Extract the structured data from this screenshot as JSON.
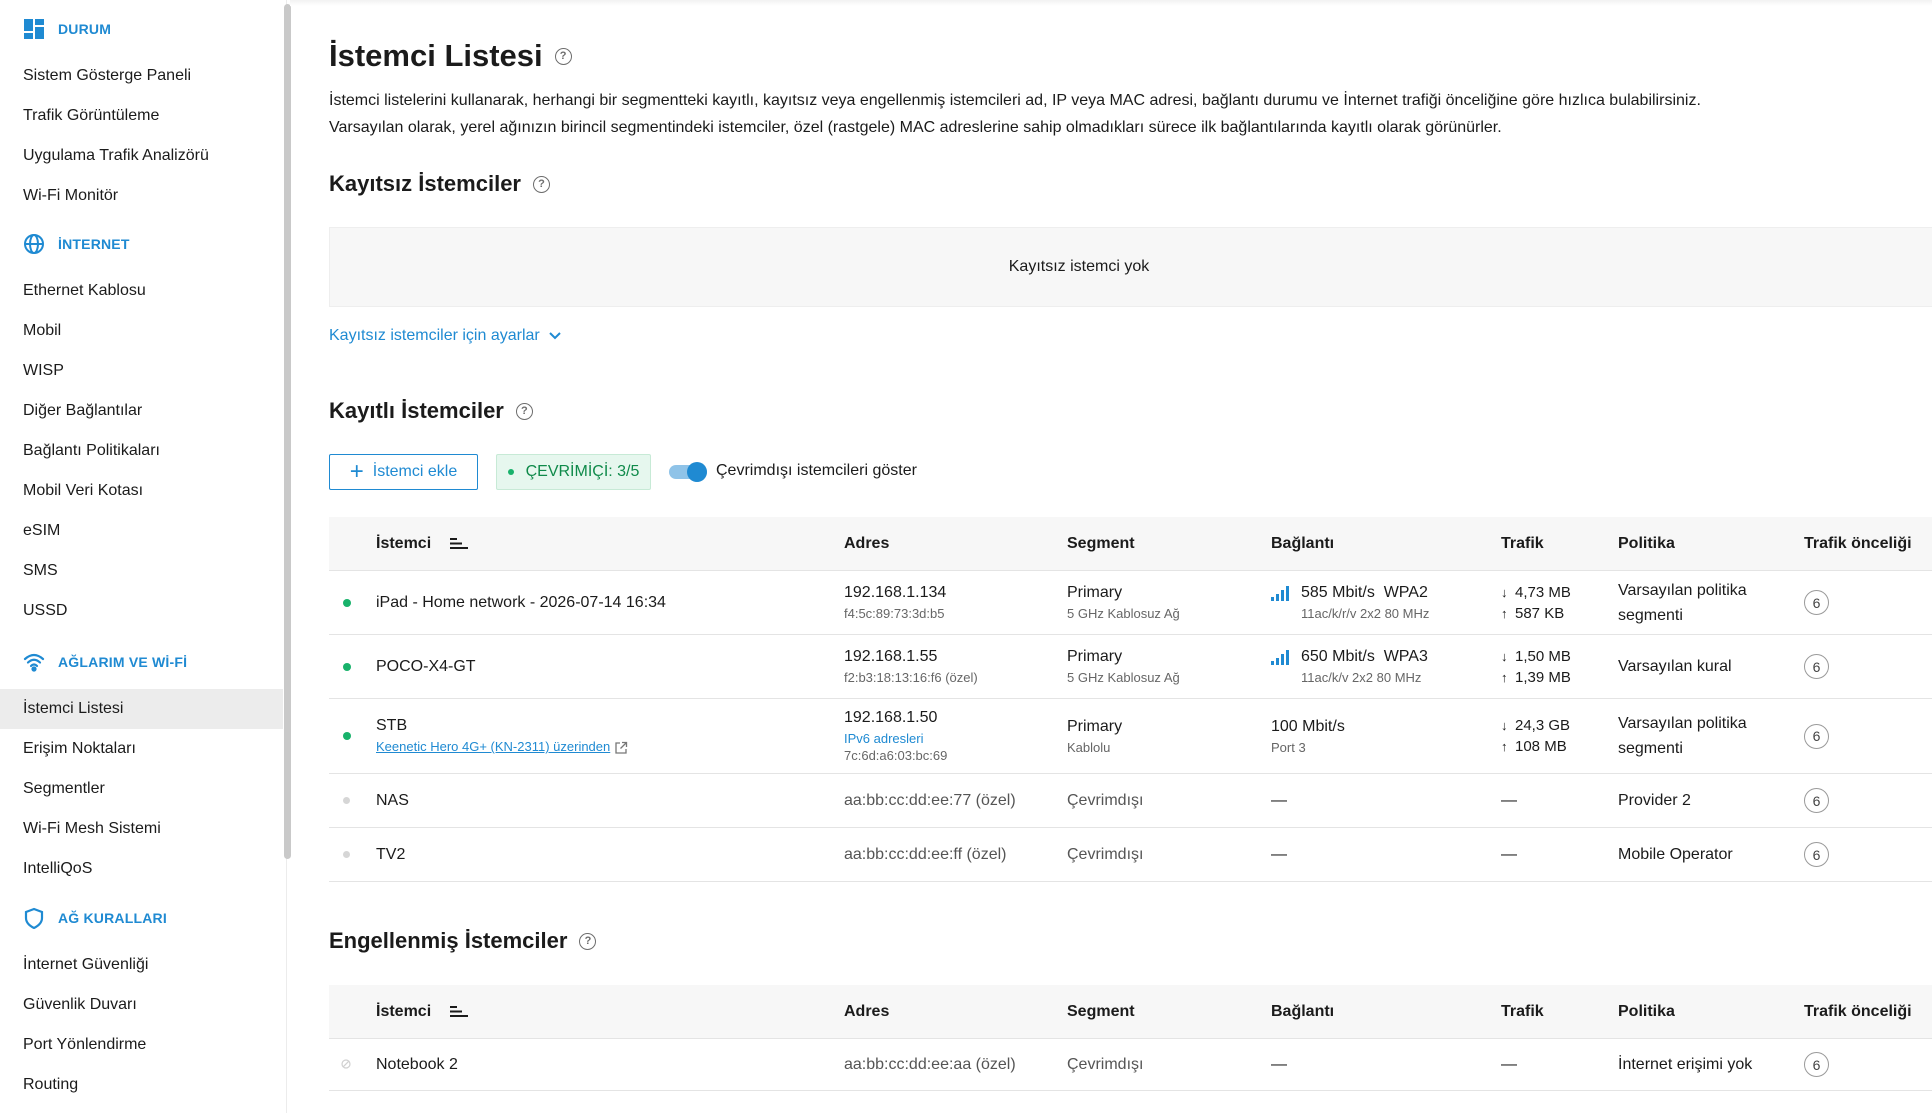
{
  "sidebar": {
    "sections": [
      {
        "title": "DURUM",
        "icon": "dashboard-icon",
        "items": [
          "Sistem Gösterge Paneli",
          "Trafik Görüntüleme",
          "Uygulama Trafik Analizörü",
          "Wi-Fi Monitör"
        ]
      },
      {
        "title": "İNTERNET",
        "icon": "globe-icon",
        "items": [
          "Ethernet Kablosu",
          "Mobil",
          "WISP",
          "Diğer Bağlantılar",
          "Bağlantı Politikaları",
          "Mobil Veri Kotası",
          "eSIM",
          "SMS",
          "USSD"
        ]
      },
      {
        "title": "AĞLARIM VE Wİ-Fİ",
        "icon": "wifi-icon",
        "items": [
          "İstemci Listesi",
          "Erişim Noktaları",
          "Segmentler",
          "Wi-Fi Mesh Sistemi",
          "IntelliQoS"
        ]
      },
      {
        "title": "AĞ KURALLARI",
        "icon": "shield-icon",
        "items": [
          "İnternet Güvenliği",
          "Güvenlik Duvarı",
          "Port Yönlendirme",
          "Routing"
        ]
      }
    ],
    "active_item": "İstemci Listesi"
  },
  "page": {
    "title": "İstemci Listesi",
    "desc_1": "İstemci listelerini kullanarak, herhangi bir segmentteki kayıtlı, kayıtsız veya engellenmiş istemcileri ad, IP veya MAC adresi, bağlantı durumu ve İnternet trafiği önceliğine göre hızlıca bulabilirsiniz.",
    "desc_2": "Varsayılan olarak, yerel ağınızın birincil segmentindeki istemciler, özel (rastgele) MAC adreslerine sahip olmadıkları sürece ilk bağlantılarında kayıtlı olarak görünürler."
  },
  "unregistered": {
    "title": "Kayıtsız İstemciler",
    "empty_text": "Kayıtsız istemci yok",
    "settings_link": "Kayıtsız istemciler için ayarlar"
  },
  "registered": {
    "title": "Kayıtlı İstemciler",
    "add_button": "İstemci ekle",
    "online_badge": "ÇEVRİMİÇİ: 3/5",
    "toggle_label": "Çevrimdışı istemcileri göster",
    "toggle_on": true,
    "columns": [
      "İstemci",
      "Adres",
      "Segment",
      "Bağlantı",
      "Trafik",
      "Politika",
      "Trafik önceliği"
    ],
    "rows": [
      {
        "online": true,
        "name": "iPad - Home network - 2026-07-14 16:34",
        "ip": "192.168.1.134",
        "mac": "f4:5c:89:73:3d:b5",
        "segment": "Primary",
        "segment_sub": "5 GHz Kablosuz Ağ",
        "speed": "585 Mbit/s  WPA2",
        "conn_sub": "11ac/k/r/v 2x2 80 MHz",
        "wifi": true,
        "down": "4,73 MB",
        "up": "587 KB",
        "policy": "Varsayılan politika segmenti",
        "priority": "6"
      },
      {
        "online": true,
        "name": "POCO-X4-GT",
        "ip": "192.168.1.55",
        "mac": "f2:b3:18:13:16:f6 (özel)",
        "segment": "Primary",
        "segment_sub": "5 GHz Kablosuz Ağ",
        "speed": "650 Mbit/s  WPA3",
        "conn_sub": "11ac/k/v 2x2 80 MHz",
        "wifi": true,
        "down": "1,50 MB",
        "up": "1,39 MB",
        "policy": "Varsayılan kural",
        "priority": "6"
      },
      {
        "online": true,
        "name": "STB",
        "name_link": "Keenetic Hero 4G+ (KN-2311) üzerinden",
        "ip": "192.168.1.50",
        "ipv6_link": "IPv6 adresleri",
        "mac": "7c:6d:a6:03:bc:69",
        "segment": "Primary",
        "segment_sub": "Kablolu",
        "speed": "100 Mbit/s",
        "conn_sub": "Port 3",
        "wifi": false,
        "down": "24,3 GB",
        "up": "108 MB",
        "policy": "Varsayılan politika segmenti",
        "priority": "6"
      },
      {
        "online": false,
        "name": "NAS",
        "mac": "aa:bb:cc:dd:ee:77 (özel)",
        "segment_sub": "Çevrimdışı",
        "speed": "—",
        "traffic": "—",
        "policy": "Provider 2",
        "priority": "6"
      },
      {
        "online": false,
        "name": "TV2",
        "mac": "aa:bb:cc:dd:ee:ff (özel)",
        "segment_sub": "Çevrimdışı",
        "speed": "—",
        "traffic": "—",
        "policy": "Mobile Operator",
        "priority": "6"
      }
    ]
  },
  "blocked": {
    "title": "Engellenmiş İstemciler",
    "rows": [
      {
        "name": "Notebook 2",
        "mac": "aa:bb:cc:dd:ee:aa (özel)",
        "segment_sub": "Çevrimdışı",
        "speed": "—",
        "traffic": "—",
        "policy": "İnternet erişimi yok",
        "priority": "6"
      }
    ]
  },
  "colors": {
    "accent": "#1f8ad2",
    "online": "#18b26b",
    "online_badge_bg": "#e6f7ee"
  }
}
